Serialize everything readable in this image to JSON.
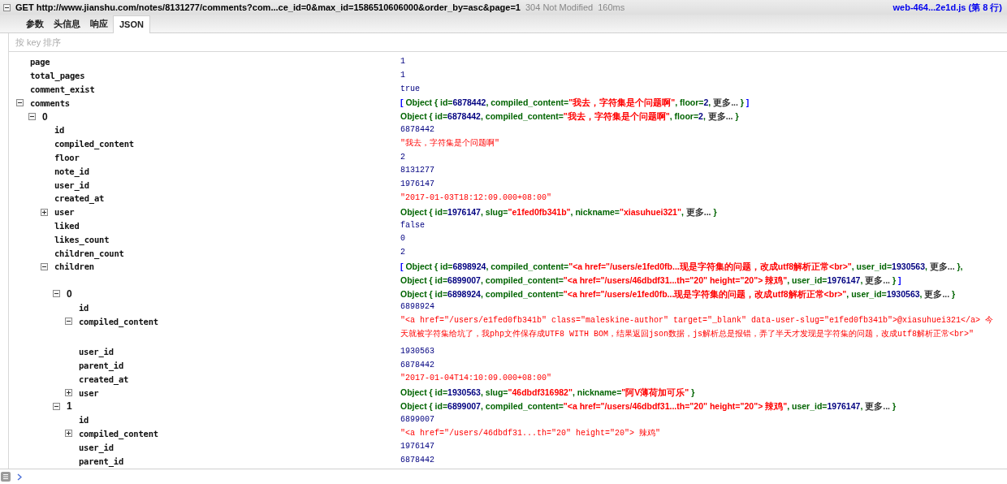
{
  "request": {
    "expanded": true,
    "method": "GET",
    "url": "http://www.jianshu.com/notes/8131277/comments?com...ce_id=0&max_id=1586510606000&order_by=asc&page=1",
    "status": "304 Not Modified",
    "time": "160ms",
    "source": "web-464...2e1d.js (第 8 行)"
  },
  "tabs": [
    {
      "label": "参数",
      "selected": false
    },
    {
      "label": "头信息",
      "selected": false
    },
    {
      "label": "响应",
      "selected": false
    },
    {
      "label": "JSON",
      "selected": true
    }
  ],
  "sort_label": "按 key 排序",
  "tree": [
    {
      "key": "page",
      "value": "1",
      "kind": "number"
    },
    {
      "key": "total_pages",
      "value": "1",
      "kind": "number"
    },
    {
      "key": "comment_exist",
      "value": "true",
      "kind": "number"
    },
    {
      "key": "comments",
      "kind": "object",
      "expanded": true,
      "preview": [
        [
          {
            "kind": "bracket",
            "text": "[ "
          },
          {
            "kind": "obj",
            "text": "Object { id="
          },
          {
            "kind": "num",
            "text": "6878442"
          },
          {
            "kind": "obj",
            "text": ",  compiled_content="
          },
          {
            "kind": "str",
            "text": "\"我去，字符集是个问题啊\""
          },
          {
            "kind": "obj",
            "text": ",  floor="
          },
          {
            "kind": "num",
            "text": "2"
          },
          {
            "kind": "obj",
            "text": ",  "
          },
          {
            "kind": "more",
            "text": "更多..."
          },
          {
            "kind": "obj",
            "text": " }"
          },
          {
            "kind": "bracket",
            "text": " ]"
          }
        ]
      ],
      "children": [
        {
          "key": "0",
          "kind": "object",
          "expanded": true,
          "preview": [
            [
              {
                "kind": "obj",
                "text": "Object { id="
              },
              {
                "kind": "num",
                "text": "6878442"
              },
              {
                "kind": "obj",
                "text": ",  compiled_content="
              },
              {
                "kind": "str",
                "text": "\"我去，字符集是个问题啊\""
              },
              {
                "kind": "obj",
                "text": ",  floor="
              },
              {
                "kind": "num",
                "text": "2"
              },
              {
                "kind": "obj",
                "text": ",  "
              },
              {
                "kind": "more",
                "text": "更多..."
              },
              {
                "kind": "obj",
                "text": " }"
              }
            ]
          ],
          "children": [
            {
              "key": "id",
              "value": "6878442",
              "kind": "number"
            },
            {
              "key": "compiled_content",
              "value": "\"我去，字符集是个问题啊\"",
              "kind": "string"
            },
            {
              "key": "floor",
              "value": "2",
              "kind": "number"
            },
            {
              "key": "note_id",
              "value": "8131277",
              "kind": "number"
            },
            {
              "key": "user_id",
              "value": "1976147",
              "kind": "number"
            },
            {
              "key": "created_at",
              "value": "\"2017-01-03T18:12:09.000+08:00\"",
              "kind": "string"
            },
            {
              "key": "user",
              "kind": "object",
              "expanded": false,
              "preview": [
                [
                  {
                    "kind": "obj",
                    "text": "Object { id="
                  },
                  {
                    "kind": "num",
                    "text": "1976147"
                  },
                  {
                    "kind": "obj",
                    "text": ",  slug="
                  },
                  {
                    "kind": "str",
                    "text": "\"e1fed0fb341b\""
                  },
                  {
                    "kind": "obj",
                    "text": ",  nickname="
                  },
                  {
                    "kind": "str",
                    "text": "\"xiasuhuei321\""
                  },
                  {
                    "kind": "obj",
                    "text": ",  "
                  },
                  {
                    "kind": "more",
                    "text": "更多..."
                  },
                  {
                    "kind": "obj",
                    "text": " }"
                  }
                ]
              ]
            },
            {
              "key": "liked",
              "value": "false",
              "kind": "number"
            },
            {
              "key": "likes_count",
              "value": "0",
              "kind": "number"
            },
            {
              "key": "children_count",
              "value": "2",
              "kind": "number"
            },
            {
              "key": "children",
              "kind": "object",
              "expanded": true,
              "preview": [
                [
                  {
                    "kind": "bracket",
                    "text": "[ "
                  },
                  {
                    "kind": "obj",
                    "text": "Object { id="
                  },
                  {
                    "kind": "num",
                    "text": "6898924"
                  },
                  {
                    "kind": "obj",
                    "text": ",  compiled_content="
                  },
                  {
                    "kind": "str",
                    "text": "\"<a href=\"/users/e1fed0fb...现是字符集的问题，改成utf8解析正常<br>\""
                  },
                  {
                    "kind": "obj",
                    "text": ",  user_id="
                  },
                  {
                    "kind": "num",
                    "text": "1930563"
                  },
                  {
                    "kind": "obj",
                    "text": ",  "
                  },
                  {
                    "kind": "more",
                    "text": "更多..."
                  },
                  {
                    "kind": "obj",
                    "text": " },"
                  }
                ],
                [
                  {
                    "kind": "obj",
                    "text": "Object { id="
                  },
                  {
                    "kind": "num",
                    "text": "6899007"
                  },
                  {
                    "kind": "obj",
                    "text": ",  compiled_content="
                  },
                  {
                    "kind": "str",
                    "text": "\"<a href=\"/users/46dbdf31...th=\"20\" height=\"20\"> 辣鸡\""
                  },
                  {
                    "kind": "obj",
                    "text": ",  user_id="
                  },
                  {
                    "kind": "num",
                    "text": "1976147"
                  },
                  {
                    "kind": "obj",
                    "text": ",  "
                  },
                  {
                    "kind": "more",
                    "text": "更多..."
                  },
                  {
                    "kind": "obj",
                    "text": " }"
                  },
                  {
                    "kind": "bracket",
                    "text": " ]"
                  }
                ]
              ],
              "children": [
                {
                  "key": "0",
                  "kind": "object",
                  "expanded": true,
                  "preview": [
                    [
                      {
                        "kind": "obj",
                        "text": "Object { id="
                      },
                      {
                        "kind": "num",
                        "text": "6898924"
                      },
                      {
                        "kind": "obj",
                        "text": ",  compiled_content="
                      },
                      {
                        "kind": "str",
                        "text": "\"<a href=\"/users/e1fed0fb...现是字符集的问题，改成utf8解析正常<br>\""
                      },
                      {
                        "kind": "obj",
                        "text": ",  user_id="
                      },
                      {
                        "kind": "num",
                        "text": "1930563"
                      },
                      {
                        "kind": "obj",
                        "text": ",  "
                      },
                      {
                        "kind": "more",
                        "text": "更多..."
                      },
                      {
                        "kind": "obj",
                        "text": " }"
                      }
                    ]
                  ],
                  "children": [
                    {
                      "key": "id",
                      "value": "6898924",
                      "kind": "number"
                    },
                    {
                      "key": "compiled_content",
                      "expanded": true,
                      "value": "\"<a href=\"/users/e1fed0fb341b\" class=\"maleskine-author\" target=\"_blank\" data-user-slug=\"e1fed0fb341b\">@xiasuhuei321</a> 今天就被字符集给坑了，我php文件保存成UTF8 WITH BOM，结果返回json数据，js解析总是报错，弄了半天才发现是字符集的问题，改成utf8解析正常<br>\"",
                      "kind": "string"
                    },
                    {
                      "key": "user_id",
                      "value": "1930563",
                      "kind": "number"
                    },
                    {
                      "key": "parent_id",
                      "value": "6878442",
                      "kind": "number"
                    },
                    {
                      "key": "created_at",
                      "value": "\"2017-01-04T14:10:09.000+08:00\"",
                      "kind": "string"
                    },
                    {
                      "key": "user",
                      "kind": "object",
                      "expanded": false,
                      "preview": [
                        [
                          {
                            "kind": "obj",
                            "text": "Object { id="
                          },
                          {
                            "kind": "num",
                            "text": "1930563"
                          },
                          {
                            "kind": "obj",
                            "text": ",  slug="
                          },
                          {
                            "kind": "str",
                            "text": "\"46dbdf316982\""
                          },
                          {
                            "kind": "obj",
                            "text": ",  nickname="
                          },
                          {
                            "kind": "str",
                            "text": "\"阿V薄荷加可乐\""
                          },
                          {
                            "kind": "obj",
                            "text": " }"
                          }
                        ]
                      ]
                    }
                  ]
                },
                {
                  "key": "1",
                  "kind": "object",
                  "expanded": true,
                  "preview": [
                    [
                      {
                        "kind": "obj",
                        "text": "Object { id="
                      },
                      {
                        "kind": "num",
                        "text": "6899007"
                      },
                      {
                        "kind": "obj",
                        "text": ",  compiled_content="
                      },
                      {
                        "kind": "str",
                        "text": "\"<a href=\"/users/46dbdf31...th=\"20\" height=\"20\"> 辣鸡\""
                      },
                      {
                        "kind": "obj",
                        "text": ",  user_id="
                      },
                      {
                        "kind": "num",
                        "text": "1976147"
                      },
                      {
                        "kind": "obj",
                        "text": ",  "
                      },
                      {
                        "kind": "more",
                        "text": "更多..."
                      },
                      {
                        "kind": "obj",
                        "text": " }"
                      }
                    ]
                  ],
                  "children": [
                    {
                      "key": "id",
                      "value": "6899007",
                      "kind": "number"
                    },
                    {
                      "key": "compiled_content",
                      "expanded": false,
                      "value": "\"<a href=\"/users/46dbdf31...th=\"20\" height=\"20\"> 辣鸡\"",
                      "kind": "string"
                    },
                    {
                      "key": "user_id",
                      "value": "1976147",
                      "kind": "number"
                    },
                    {
                      "key": "parent_id",
                      "value": "6878442",
                      "kind": "number"
                    }
                  ]
                }
              ]
            }
          ]
        }
      ]
    }
  ]
}
